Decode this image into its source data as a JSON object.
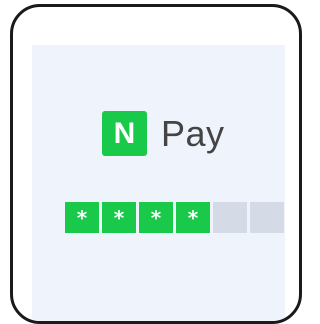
{
  "brand": {
    "logo_letter": "N",
    "name": "Pay"
  },
  "pin": {
    "total_digits": 6,
    "filled_digits": 4,
    "mask_char": "*"
  },
  "colors": {
    "accent": "#19c94a",
    "screen_background": "#eef3fc",
    "empty_slot": "#d5dbe6",
    "device_border": "#1a1a1a",
    "brand_text": "#444444"
  }
}
